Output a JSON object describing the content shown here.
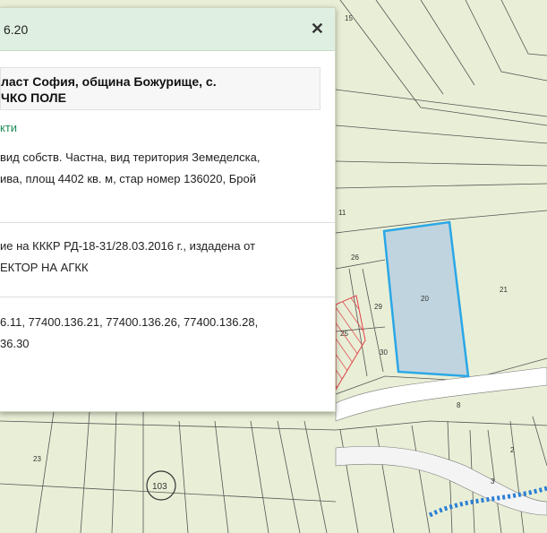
{
  "popup": {
    "title": "6.20",
    "close_label": "✕",
    "address_line1": "ласт София, община Божурище, с.",
    "address_line2": "ЧКО ПОЛЕ",
    "objects_link": "кти",
    "details_line1": "вид собств. Частна, вид територия Земеделска,",
    "details_line2": "ива, площ 4402 кв. м, стар номер 136020, Брой",
    "order_line1": "ие на КККР РД-18-31/28.03.2016 г., издадена от",
    "order_line2": "ЕКТОР НА АГКК",
    "neighbors_line1": "6.11,   77400.136.21,   77400.136.26,   77400.136.28,",
    "neighbors_line2": "36.30"
  },
  "map": {
    "parcel_labels": {
      "p15": "15",
      "p11": "11",
      "p26": "26",
      "p20": "20",
      "p21": "21",
      "p29": "29",
      "p25": "25",
      "p30": "30",
      "p8": "8",
      "p23": "23",
      "p103": "103",
      "p2": "2",
      "p3": "3"
    },
    "colors": {
      "background": "#e9efd6",
      "selected_fill": "#b9cfe0",
      "selected_border": "#2aa7e6",
      "hatch": "#e0434a"
    }
  }
}
